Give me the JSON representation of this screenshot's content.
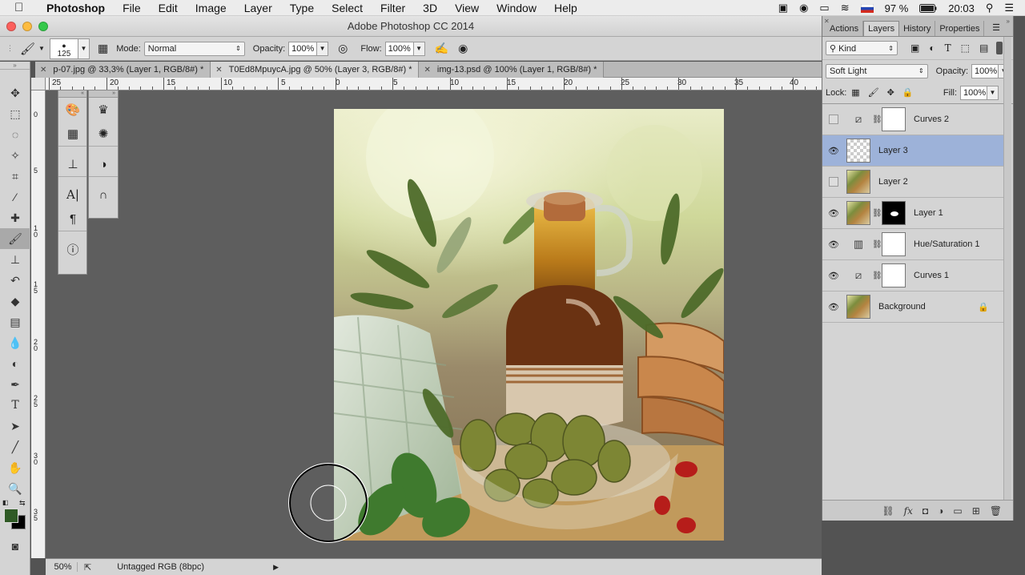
{
  "menubar": {
    "items": [
      "Photoshop",
      "File",
      "Edit",
      "Image",
      "Layer",
      "Type",
      "Select",
      "Filter",
      "3D",
      "View",
      "Window",
      "Help"
    ],
    "battery": "97 %",
    "time": "20:03"
  },
  "window": {
    "title": "Adobe Photoshop CC 2014"
  },
  "options": {
    "brush_size": "125",
    "mode_label": "Mode:",
    "mode_value": "Normal",
    "opacity_label": "Opacity:",
    "opacity_value": "100%",
    "flow_label": "Flow:",
    "flow_value": "100%"
  },
  "tabs": [
    {
      "label": "p-07.jpg @ 33,3% (Layer 1, RGB/8#) *"
    },
    {
      "label": "T0Ed8MpuycA.jpg @ 50% (Layer 3, RGB/8#) *"
    },
    {
      "label": "img-13.psd @ 100% (Layer 1, RGB/8#) *"
    }
  ],
  "ruler": {
    "top": [
      "25",
      "20",
      "15",
      "10",
      "5",
      "0",
      "5",
      "10",
      "15",
      "20",
      "25",
      "30",
      "35",
      "40"
    ],
    "left": [
      "0",
      "5",
      "1 0",
      "1 5",
      "2 0",
      "2 5",
      "3 0",
      "3 5"
    ]
  },
  "status": {
    "zoom": "50%",
    "profile": "Untagged RGB (8bpc)"
  },
  "panel": {
    "tabs": [
      "Actions",
      "Layers",
      "History",
      "Properties"
    ],
    "filter_kind": "Kind",
    "blend_mode": "Soft Light",
    "opacity_label": "Opacity:",
    "opacity_value": "100%",
    "lock_label": "Lock:",
    "fill_label": "Fill:",
    "fill_value": "100%",
    "layers": [
      {
        "name": "Curves 2",
        "visible": false
      },
      {
        "name": "Layer 3",
        "visible": true
      },
      {
        "name": "Layer 2",
        "visible": false
      },
      {
        "name": "Layer 1",
        "visible": true
      },
      {
        "name": "Hue/Saturation 1",
        "visible": true
      },
      {
        "name": "Curves 1",
        "visible": true
      },
      {
        "name": "Background",
        "visible": true
      }
    ]
  },
  "colors": {
    "foreground": "#2f5a25",
    "background": "#000000",
    "selected_layer": "#9db2d9"
  }
}
